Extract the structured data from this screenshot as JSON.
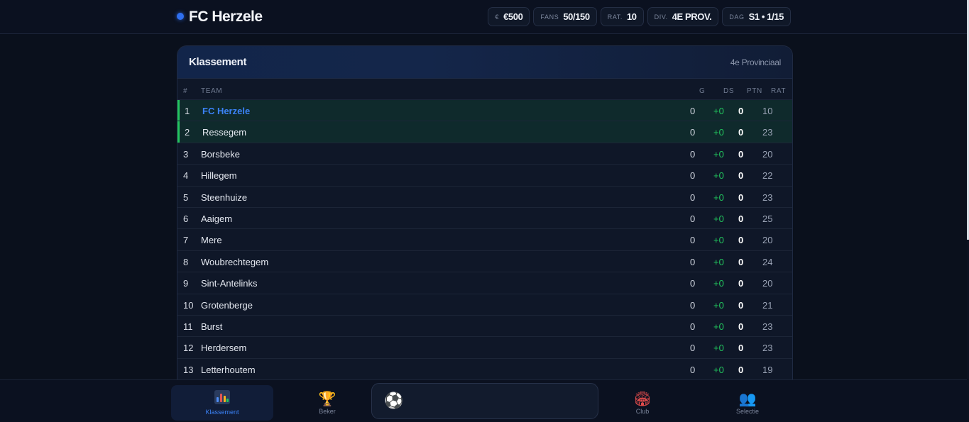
{
  "header": {
    "club_name": "FC Herzele",
    "stats": [
      {
        "key": "€",
        "value": "€500"
      },
      {
        "key": "FANS",
        "value": "50/150"
      },
      {
        "key": "RAT.",
        "value": "10"
      },
      {
        "key": "DIV.",
        "value": "4E PROV."
      },
      {
        "key": "DAG",
        "value": "S1 • 1/15"
      }
    ]
  },
  "standings": {
    "title": "Klassement",
    "division": "4e Provinciaal",
    "columns": {
      "rank": "#",
      "team": "TEAM",
      "g": "G",
      "ds": "DS",
      "ptn": "PTN",
      "rat": "RAT"
    },
    "rows": [
      {
        "rank": "1",
        "team": "FC Herzele",
        "g": "0",
        "ds": "+0",
        "ptn": "0",
        "rat": "10"
      },
      {
        "rank": "2",
        "team": "Ressegem",
        "g": "0",
        "ds": "+0",
        "ptn": "0",
        "rat": "23"
      },
      {
        "rank": "3",
        "team": "Borsbeke",
        "g": "0",
        "ds": "+0",
        "ptn": "0",
        "rat": "20"
      },
      {
        "rank": "4",
        "team": "Hillegem",
        "g": "0",
        "ds": "+0",
        "ptn": "0",
        "rat": "22"
      },
      {
        "rank": "5",
        "team": "Steenhuize",
        "g": "0",
        "ds": "+0",
        "ptn": "0",
        "rat": "23"
      },
      {
        "rank": "6",
        "team": "Aaigem",
        "g": "0",
        "ds": "+0",
        "ptn": "0",
        "rat": "25"
      },
      {
        "rank": "7",
        "team": "Mere",
        "g": "0",
        "ds": "+0",
        "ptn": "0",
        "rat": "20"
      },
      {
        "rank": "8",
        "team": "Woubrechtegem",
        "g": "0",
        "ds": "+0",
        "ptn": "0",
        "rat": "24"
      },
      {
        "rank": "9",
        "team": "Sint-Antelinks",
        "g": "0",
        "ds": "+0",
        "ptn": "0",
        "rat": "20"
      },
      {
        "rank": "10",
        "team": "Grotenberge",
        "g": "0",
        "ds": "+0",
        "ptn": "0",
        "rat": "21"
      },
      {
        "rank": "11",
        "team": "Burst",
        "g": "0",
        "ds": "+0",
        "ptn": "0",
        "rat": "23"
      },
      {
        "rank": "12",
        "team": "Herdersem",
        "g": "0",
        "ds": "+0",
        "ptn": "0",
        "rat": "23"
      },
      {
        "rank": "13",
        "team": "Letterhoutem",
        "g": "0",
        "ds": "+0",
        "ptn": "0",
        "rat": "19"
      }
    ]
  },
  "nav": {
    "items": [
      {
        "label": "Klassement",
        "icon": "bar-chart-icon",
        "active": true
      },
      {
        "label": "Beker",
        "icon": "trophy-icon",
        "active": false
      },
      {
        "label": "Club",
        "icon": "stadium-icon",
        "active": false
      },
      {
        "label": "Selectie",
        "icon": "users-icon",
        "active": false
      }
    ],
    "play_icon": "soccer-ball-icon"
  },
  "colors": {
    "accent": "#3b82f6",
    "promotion": "#22c55e",
    "background": "#0a101c",
    "card": "#0f1728"
  }
}
